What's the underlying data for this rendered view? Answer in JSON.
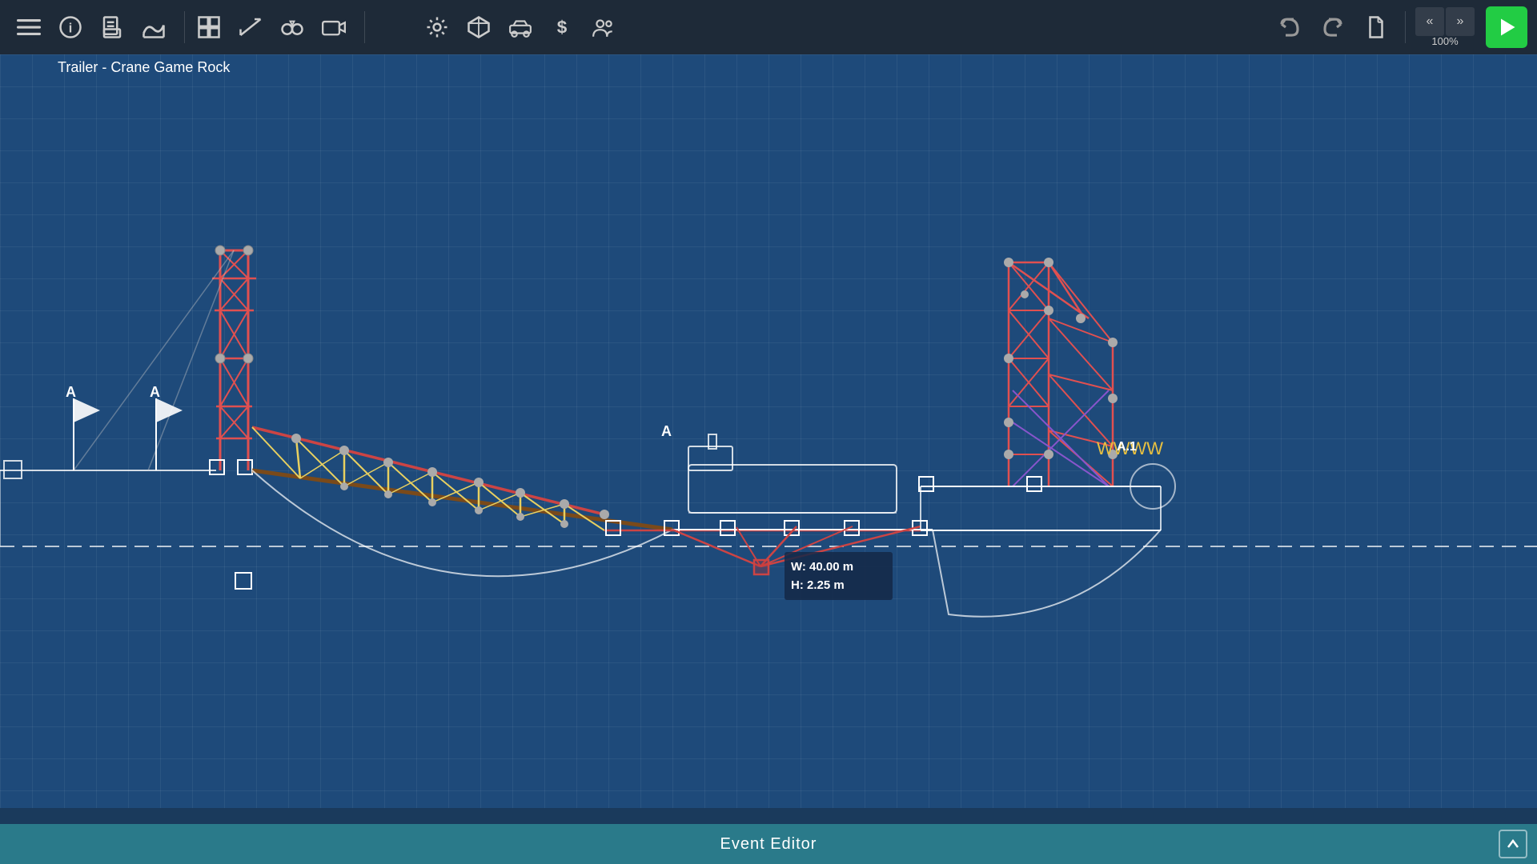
{
  "toolbar": {
    "title": "Trailer - Crane Game Rock",
    "subtitle": "Trailer - Crane Game Rock",
    "zoom_label": "100%",
    "play_label": "▶",
    "buttons": {
      "menu": "☰",
      "info": "ℹ",
      "doc": "📄",
      "bridge": "🌉",
      "grid": "⊞",
      "measure": "📐",
      "binoculars": "🔭",
      "camera": "🎥",
      "settings": "⚙",
      "cube": "📦",
      "car": "🚗",
      "money": "$",
      "people": "👥",
      "undo": "↩",
      "redo": "↪",
      "newdoc": "📋",
      "nav_left": "«",
      "nav_right": "»"
    }
  },
  "scene": {
    "measurement": {
      "width_label": "W: 40.00 m",
      "height_label": "H: 2.25 m"
    },
    "anchor_labels": [
      "A",
      "A",
      "A",
      "A.1"
    ]
  },
  "bottom_bar": {
    "label": "Event Editor",
    "expand_icon": "▲"
  }
}
